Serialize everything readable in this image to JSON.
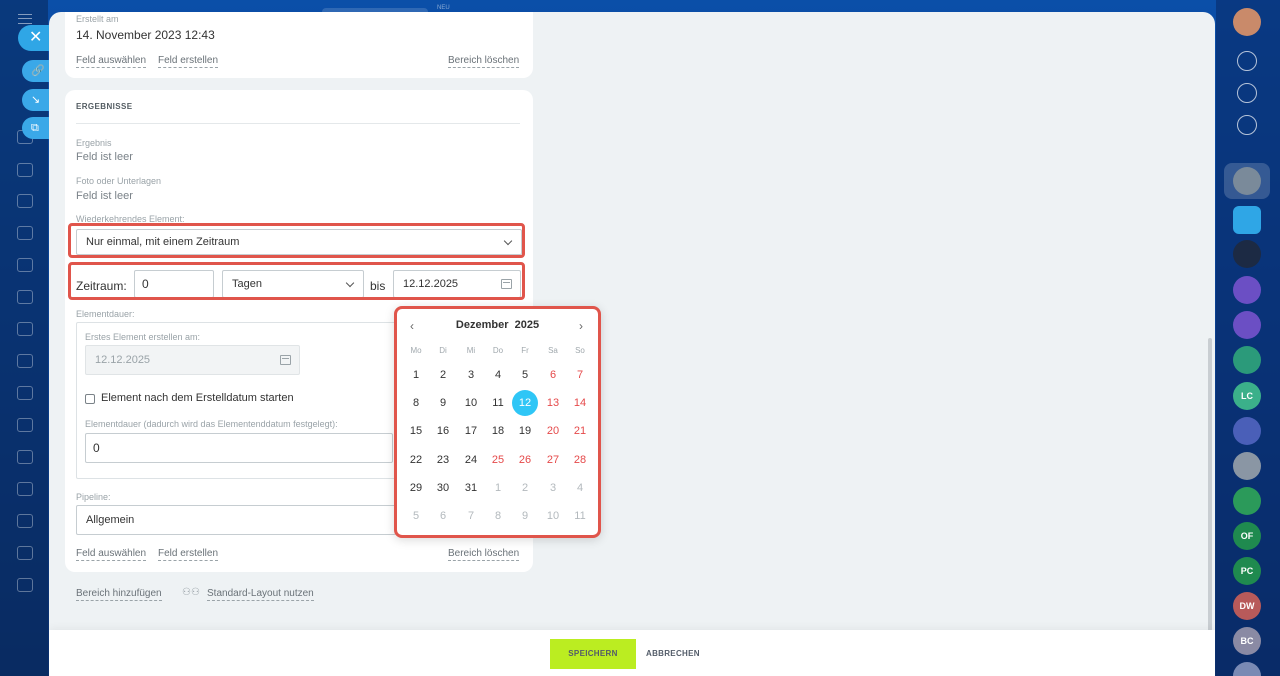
{
  "top_new": "NEU",
  "created": {
    "label": "Erstellt am",
    "value": "14. November 2023 12:43"
  },
  "section1_links": {
    "select_field": "Feld auswählen",
    "create_field": "Feld erstellen",
    "clear_section": "Bereich löschen"
  },
  "results": {
    "title": "ERGEBNISSE",
    "result_label": "Ergebnis",
    "result_value": "Feld ist leer",
    "photo_label": "Foto oder Unterlagen",
    "photo_value": "Feld ist leer",
    "recurring_label": "Wiederkehrendes Element:",
    "recurring_value": "Nur einmal, mit einem Zeitraum",
    "period_label": "Zeitraum:",
    "period_value": "0",
    "period_unit": "Tagen",
    "until_label": "bis",
    "until_date": "12.12.2025",
    "element_duration_label": "Elementdauer:",
    "first_element_label": "Erstes Element erstellen am:",
    "first_element_date": "12.12.2025",
    "start_after_label": "Element nach dem Erstelldatum starten",
    "duration_label": "Elementdauer (dadurch wird das Elementenddatum festgelegt):",
    "duration_value": "0",
    "pipeline_label": "Pipeline:",
    "pipeline_value": "Allgemein",
    "select_field": "Feld auswählen",
    "create_field": "Feld erstellen",
    "clear_section": "Bereich löschen"
  },
  "bottom_links": {
    "add_section": "Bereich hinzufügen",
    "standard_layout": "Standard-Layout nutzen"
  },
  "footer": {
    "save": "SPEICHERN",
    "cancel": "ABBRECHEN"
  },
  "calendar": {
    "month": "Dezember",
    "year": "2025",
    "weekdays": [
      "Mo",
      "Di",
      "Mi",
      "Do",
      "Fr",
      "Sa",
      "So"
    ],
    "selected_day": "12",
    "weeks": [
      [
        "1",
        "2",
        "3",
        "4",
        "5",
        "6",
        "7"
      ],
      [
        "8",
        "9",
        "10",
        "11",
        "12",
        "13",
        "14"
      ],
      [
        "15",
        "16",
        "17",
        "18",
        "19",
        "20",
        "21"
      ],
      [
        "22",
        "23",
        "24",
        "25",
        "26",
        "27",
        "28"
      ],
      [
        "29",
        "30",
        "31",
        "1",
        "2",
        "3",
        "4"
      ],
      [
        "5",
        "6",
        "7",
        "8",
        "9",
        "10",
        "11"
      ]
    ]
  },
  "right_bar_initials": [
    "LC",
    "OF",
    "PC",
    "DW",
    "BC"
  ],
  "colors": {
    "accent": "#2fc6f6",
    "save_green": "#bbed21",
    "highlight_red": "#e0554b",
    "weekend_red": "#e5494a"
  }
}
